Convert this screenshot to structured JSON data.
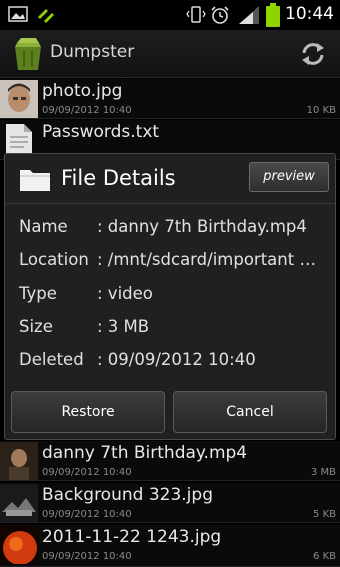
{
  "status_bar": {
    "time": "10:44",
    "icons": [
      "image-notification-icon",
      "usb-icon",
      "vibrate-icon",
      "alarm-icon",
      "signal-icon",
      "battery-icon"
    ]
  },
  "action_bar": {
    "title": "Dumpster",
    "app_icon": "trash-bin-icon",
    "refresh_icon": "refresh-icon"
  },
  "files": [
    {
      "name": "photo.jpg",
      "date": "09/09/2012 10:40",
      "size": "10 KB",
      "thumb": "photo-thumbnail"
    },
    {
      "name": "Passwords.txt",
      "date": "",
      "size": "",
      "thumb": "document-icon"
    },
    {
      "name": "danny 7th Birthday.mp4",
      "date": "09/09/2012 10:40",
      "size": "3 MB",
      "thumb": "video-thumbnail"
    },
    {
      "name": "Background  323.jpg",
      "date": "09/09/2012 10:40",
      "size": "5 KB",
      "thumb": "image-thumbnail"
    },
    {
      "name": "2011-11-22 1243.jpg",
      "date": "09/09/2012 10:40",
      "size": "6 KB",
      "thumb": "image-thumbnail"
    }
  ],
  "dialog": {
    "title": "File Details",
    "preview_label": "preview",
    "details": [
      {
        "label": "Name",
        "value": ": danny 7th Birthday.mp4"
      },
      {
        "label": "Location",
        "value": ": /mnt/sdcard/important files/"
      },
      {
        "label": "Type",
        "value": ": video"
      },
      {
        "label": "Size",
        "value": ": 3 MB"
      },
      {
        "label": "Deleted",
        "value": ": 09/09/2012 10:40"
      }
    ],
    "restore_label": "Restore",
    "cancel_label": "Cancel"
  },
  "colors": {
    "background": "#000000",
    "dialog_bg": "#202020",
    "battery": "#8fd400",
    "app_icon_green": "#6b8e23"
  }
}
